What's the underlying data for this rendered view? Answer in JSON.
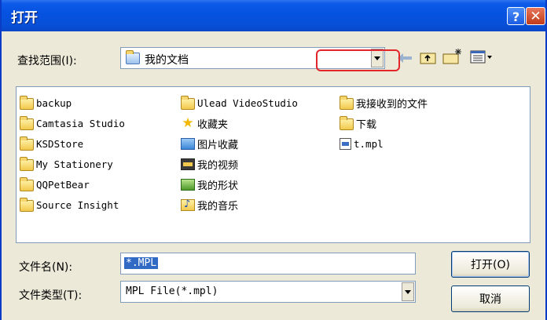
{
  "dialog": {
    "title": "打开",
    "help_glyph": "?",
    "close_glyph": "✕"
  },
  "look_in": {
    "label": "查找范围(I):",
    "value": "我的文档"
  },
  "toolbar": {
    "icons": [
      "back-arrow-icon",
      "up-folder-icon",
      "new-folder-icon",
      "view-menu-icon"
    ]
  },
  "files": [
    {
      "name": "backup",
      "icon": "folder"
    },
    {
      "name": "Camtasia Studio",
      "icon": "folder"
    },
    {
      "name": "KSDStore",
      "icon": "folder"
    },
    {
      "name": "My Stationery",
      "icon": "folder"
    },
    {
      "name": "QQPetBear",
      "icon": "folder"
    },
    {
      "name": "Source Insight",
      "icon": "folder"
    },
    {
      "name": "Ulead VideoStudio",
      "icon": "folder"
    },
    {
      "name": "收藏夹",
      "icon": "star"
    },
    {
      "name": "图片收藏",
      "icon": "pictures"
    },
    {
      "name": "我的视频",
      "icon": "video"
    },
    {
      "name": "我的形状",
      "icon": "shapes"
    },
    {
      "name": "我的音乐",
      "icon": "music"
    },
    {
      "name": "我接收到的文件",
      "icon": "folder"
    },
    {
      "name": "下载",
      "icon": "folder"
    },
    {
      "name": "t.mpl",
      "icon": "mpl-file",
      "highlighted": true
    }
  ],
  "filename": {
    "label": "文件名(N):",
    "value": "*.MPL"
  },
  "filetype": {
    "label": "文件类型(T):",
    "value": "MPL File(*.mpl)"
  },
  "buttons": {
    "open": "打开(O)",
    "cancel": "取消"
  },
  "colors": {
    "title_bar": "#0552e0",
    "highlight_box": "#e3262c",
    "selection": "#316ac5"
  }
}
